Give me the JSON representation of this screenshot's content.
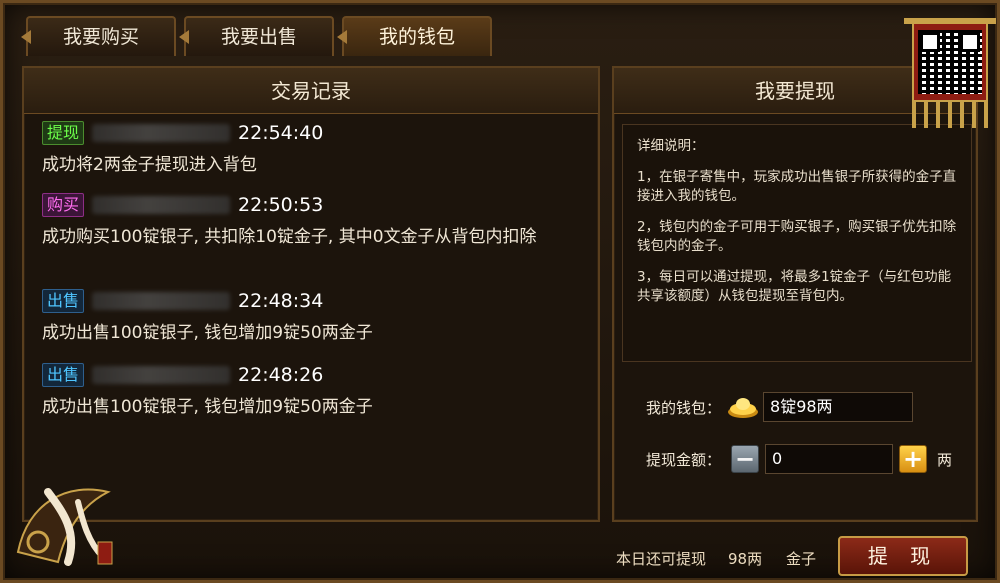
{
  "tabs": [
    {
      "label": "我要购买"
    },
    {
      "label": "我要出售"
    },
    {
      "label": "我的钱包"
    }
  ],
  "left_panel": {
    "title": "交易记录",
    "records": [
      {
        "badge": "提现",
        "time": "22:54:40",
        "desc": "成功将2两金子提现进入背包"
      },
      {
        "badge": "购买",
        "time": "22:50:53",
        "desc": "成功购买100锭银子, 共扣除10锭金子, 其中0文金子从背包内扣除"
      },
      {
        "badge": "出售",
        "time": "22:48:34",
        "desc": "成功出售100锭银子, 钱包增加9锭50两金子"
      },
      {
        "badge": "出售",
        "time": "22:48:26",
        "desc": "成功出售100锭银子, 钱包增加9锭50两金子"
      }
    ]
  },
  "right_panel": {
    "title": "我要提现",
    "details_heading": "详细说明：",
    "details": [
      "1，在银子寄售中，玩家成功出售银子所获得的金子直接进入我的钱包。",
      "2，钱包内的金子可用于购买银子，购买银子优先扣除钱包内的金子。",
      "3，每日可以通过提现，将最多1锭金子（与红包功能共享该额度）从钱包提现至背包内。"
    ],
    "wallet_label": "我的钱包：",
    "wallet_value": "8锭98两",
    "amount_label": "提现金额：",
    "amount_value": "0",
    "amount_unit": "两"
  },
  "footer": {
    "daily_label": "本日还可提现",
    "daily_value": "98两",
    "daily_unit": "金子",
    "withdraw_button": "提 现"
  },
  "colors": {
    "badge_green": "#6dff4a",
    "badge_purple": "#ff6df0",
    "badge_blue": "#4fc6ff",
    "frame_gold": "#6b4a22"
  },
  "icons": [
    "qr-code-icon",
    "gold-ingot-icon",
    "minus-icon",
    "plus-icon",
    "game-logo"
  ]
}
